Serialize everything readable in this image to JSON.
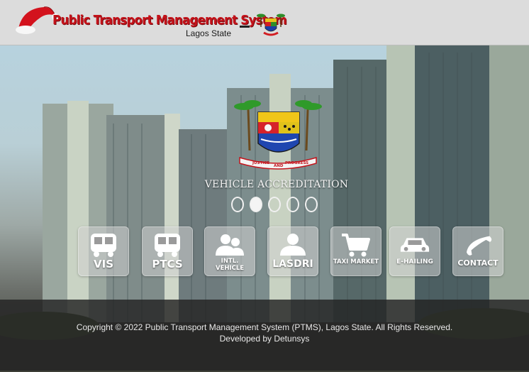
{
  "header": {
    "title": "Public Transport Management System",
    "subtitle": "Lagos State",
    "separator": "–"
  },
  "hero": {
    "slide_title": "VEHICLE ACCREDITATION",
    "crest_motto_left": "JUSTICE",
    "crest_motto_mid": "AND",
    "crest_motto_right": "PROGRESS",
    "carousel": {
      "count": 5,
      "active_index": 1
    }
  },
  "tiles": [
    {
      "label": "VIS",
      "icon": "bus-icon"
    },
    {
      "label": "PTCS",
      "icon": "bus-icon"
    },
    {
      "label_line1": "INTL.",
      "label_line2": "VEHICLE",
      "icon": "users-icon"
    },
    {
      "label": "LASDRI",
      "icon": "user-icon"
    },
    {
      "label": "TAXI MARKET",
      "icon": "cart-icon"
    },
    {
      "label": "E-HAILING",
      "icon": "car-icon"
    },
    {
      "label": "CONTACT",
      "icon": "phone-icon"
    }
  ],
  "footer": {
    "copyright": "Copyright © 2022 Public Transport Management System (PTMS), Lagos State. All Rights Reserved.",
    "developer": "Developed by Detunsys"
  },
  "colors": {
    "brand_red": "#c4121a",
    "header_bg": "#dcdcdc",
    "footer_bg": "#232323",
    "tile_bg": "#d2d2d2"
  }
}
